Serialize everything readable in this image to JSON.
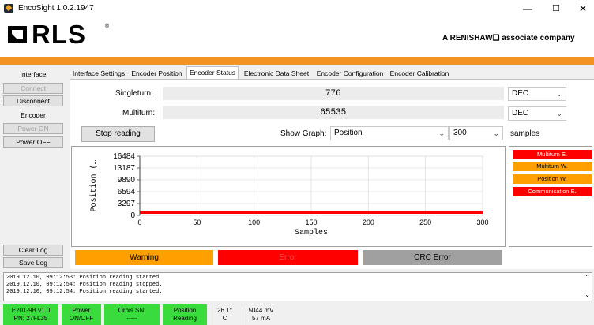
{
  "window": {
    "title": "EncoSight 1.0.2.1947",
    "minimize": "—",
    "maximize": "☐",
    "close": "✕"
  },
  "header": {
    "logo": "RLS",
    "logo_reg": "®",
    "tagline": "A RENISHAW❑ associate company",
    "accent_color": "#f39321"
  },
  "sidebar": {
    "title": "Interface",
    "connect": "Connect",
    "disconnect": "Disconnect",
    "encoder": "Encoder",
    "power_on": "Power ON",
    "power_off": "Power OFF",
    "clear_log": "Clear Log",
    "save_log": "Save Log"
  },
  "tabs": [
    "Interface Settings",
    "Encoder Position",
    "Encoder Status",
    "Electronic Data Sheet",
    "Encoder Configuration",
    "Encoder Calibration"
  ],
  "main": {
    "singleturn_label": "Singleturn:",
    "singleturn_value": "776",
    "singleturn_format": "DEC",
    "multiturn_label": "Multiturn:",
    "multiturn_value": "65535",
    "multiturn_format": "DEC",
    "stop_button": "Stop reading",
    "show_graph_label": "Show Graph:",
    "graph_select": "Position",
    "samples_select": "300",
    "samples_label": "samples"
  },
  "status_list": {
    "items": [
      {
        "label": "Multiturn E.",
        "color": "#ff0000",
        "text_color": "#ffffff"
      },
      {
        "label": "Multiturn W.",
        "color": "#ffa000",
        "text_color": "#000000"
      },
      {
        "label": "Position W.",
        "color": "#ffa000",
        "text_color": "#000000"
      },
      {
        "label": "Communication E.",
        "color": "#ff0000",
        "text_color": "#ffffff"
      }
    ]
  },
  "indicators": {
    "warning": "Warning",
    "warning_color": "#ffa000",
    "error": "Error",
    "error_color": "#ff0000",
    "crc": "CRC Error",
    "crc_color": "#a0a0a0"
  },
  "log": [
    "2019.12.10, 09:12:53: Position reading started.",
    "2019.12.10, 09:12:54: Position reading stopped.",
    "2019.12.10, 09:12:54: Position reading started."
  ],
  "statusbar": {
    "device_line1": "E201-9B v1.0",
    "device_line2": "PN: 27FL35",
    "power_line1": "Power",
    "power_line2": "ON/OFF",
    "orbis_line1": "Orbis SN:",
    "orbis_line2": "-----",
    "position_line1": "Position",
    "position_line2": "Reading",
    "temp_line1": "26.1°",
    "temp_line2": "C",
    "volt_line1": "5044 mV",
    "volt_line2": "57 mA"
  },
  "chart_data": {
    "type": "line",
    "title": "",
    "xlabel": "Samples",
    "ylabel": "Position (…",
    "xlim": [
      0,
      300
    ],
    "ylim": [
      0,
      16484
    ],
    "x_ticks": [
      "0",
      "50",
      "100",
      "150",
      "200",
      "250",
      "300"
    ],
    "y_ticks": [
      "0",
      "3297",
      "6594",
      "9890",
      "13187",
      "16484"
    ],
    "series": [
      {
        "color": "#ff0000",
        "x": [
          0,
          300
        ],
        "y": [
          776,
          776
        ]
      }
    ],
    "grid": true
  }
}
